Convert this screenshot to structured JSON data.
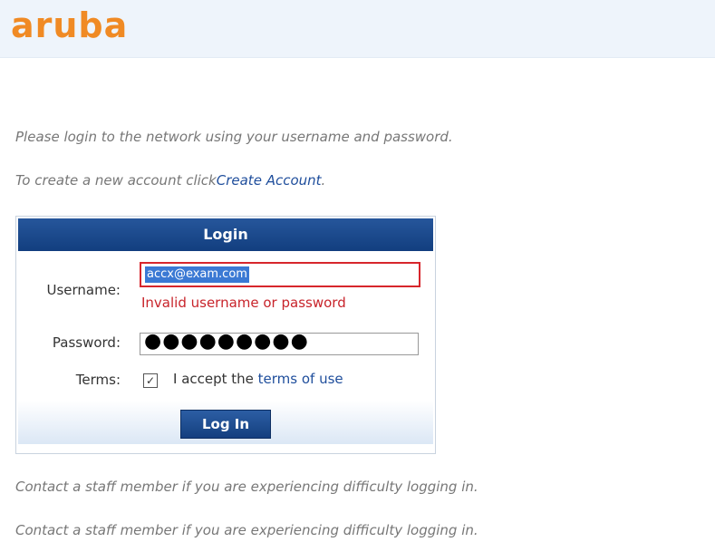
{
  "brand": {
    "logo_text": "aruba",
    "accent_color": "#f08a24"
  },
  "intro": {
    "line1": "Please login to the network using your username and password.",
    "line2_prefix": "To create a new account click",
    "create_account_link": "Create Account",
    "line2_suffix": "."
  },
  "login_box": {
    "title": "Login",
    "username_label": "Username:",
    "username_value": "accx@exam.com",
    "error_message": "Invalid username or password",
    "password_label": "Password:",
    "password_value": "●●●●●●●●●",
    "terms_label": "Terms:",
    "terms_checked": true,
    "terms_text": "I accept the ",
    "terms_link": "terms of use",
    "submit_label": "Log In"
  },
  "footer": {
    "contact_line_1": "Contact a staff member if you are experiencing difficulty logging in.",
    "contact_line_2": "Contact a staff member if you are experiencing difficulty logging in."
  }
}
